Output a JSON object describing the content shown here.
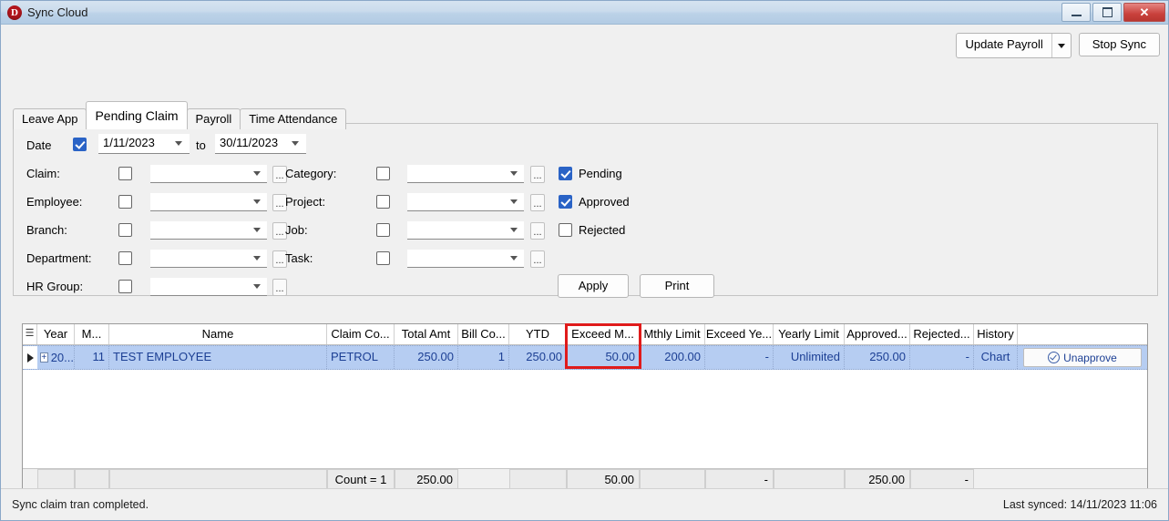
{
  "window": {
    "title": "Sync Cloud",
    "icon": "D",
    "minimize": "minimize",
    "maximize": "maximize",
    "close": "close"
  },
  "toolbar": {
    "update_payroll_label": "Update Payroll",
    "stop_sync_label": "Stop Sync"
  },
  "tabs": [
    {
      "label": "Leave App",
      "active": false
    },
    {
      "label": "Pending Claim",
      "active": true
    },
    {
      "label": "Payroll",
      "active": false
    },
    {
      "label": "Time Attendance",
      "active": false
    }
  ],
  "filters": {
    "date": {
      "label": "Date",
      "checked": true,
      "from": "1/11/2023",
      "to_label": "to",
      "to": "30/11/2023"
    },
    "left_column": [
      {
        "label": "Claim:",
        "checked": false,
        "value": ""
      },
      {
        "label": "Employee:",
        "checked": false,
        "value": ""
      },
      {
        "label": "Branch:",
        "checked": false,
        "value": ""
      },
      {
        "label": "Department:",
        "checked": false,
        "value": ""
      },
      {
        "label": "HR Group:",
        "checked": false,
        "value": ""
      }
    ],
    "middle_column": [
      {
        "label": "Category:",
        "checked": false,
        "value": ""
      },
      {
        "label": "Project:",
        "checked": false,
        "value": ""
      },
      {
        "label": "Job:",
        "checked": false,
        "value": ""
      },
      {
        "label": "Task:",
        "checked": false,
        "value": ""
      }
    ],
    "status_checks": [
      {
        "label": "Pending",
        "checked": true
      },
      {
        "label": "Approved",
        "checked": true
      },
      {
        "label": "Rejected",
        "checked": false
      }
    ],
    "ellipsis_label": "...",
    "apply_label": "Apply",
    "print_label": "Print"
  },
  "grid": {
    "columns": [
      "Year",
      "M...",
      "Name",
      "Claim Co...",
      "Total Amt",
      "Bill Co...",
      "YTD",
      "Exceed M...",
      "Mthly Limit",
      "Exceed Ye...",
      "Yearly Limit",
      "Approved...",
      "Rejected...",
      "History",
      ""
    ],
    "rows": [
      {
        "year": "20...",
        "month": "11",
        "name": "TEST EMPLOYEE",
        "claim_code": "PETROL",
        "total_amt": "250.00",
        "bill_count": "1",
        "ytd": "250.00",
        "exceed_mthly": "50.00",
        "mthly_limit": "200.00",
        "exceed_yearly": "-",
        "yearly_limit": "Unlimited",
        "approved": "250.00",
        "rejected": "-",
        "history": "Chart",
        "action": "Unapprove"
      }
    ],
    "footer": {
      "count": "Count = 1",
      "total_amt": "250.00",
      "exceed_mthly": "50.00",
      "exceed_yearly": "-",
      "approved": "250.00",
      "rejected": "-"
    }
  },
  "statusbar": {
    "message": "Sync claim tran completed.",
    "last_synced": "Last synced: 14/11/2023 11:06"
  },
  "colors": {
    "accent": "#2a63c6",
    "row_selection": "#b6cdf2",
    "highlight_box": "#e01b1b",
    "title_bar": "#bcd2e7"
  }
}
